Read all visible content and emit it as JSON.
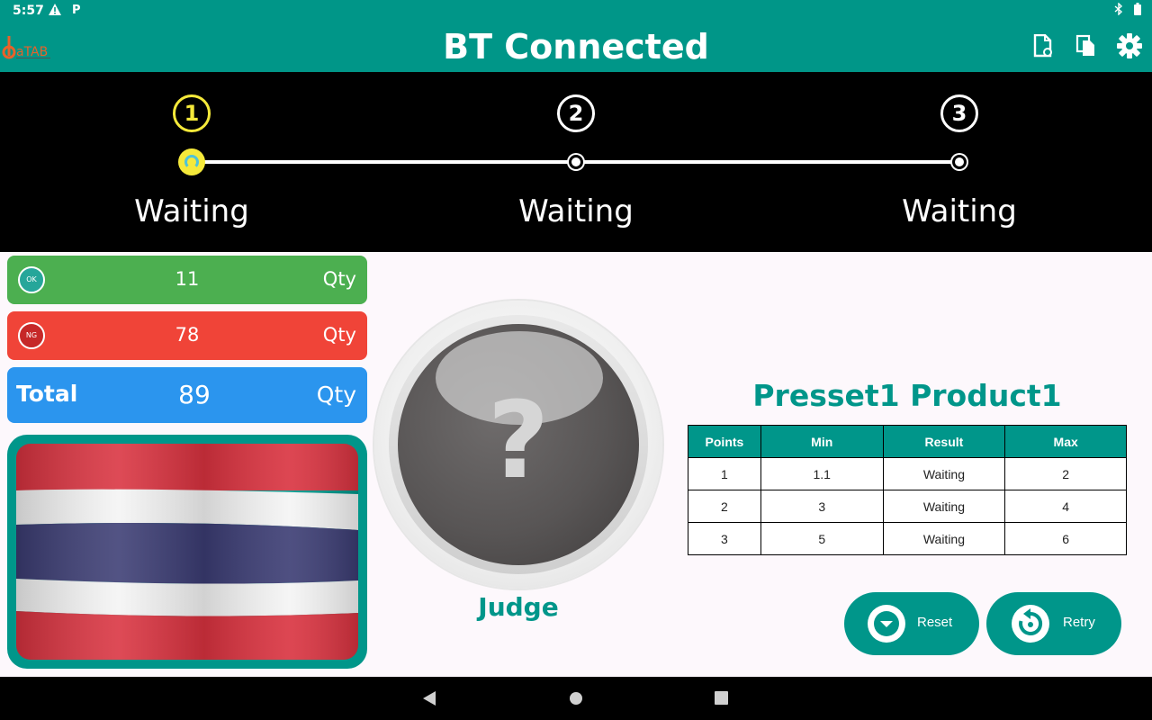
{
  "status_bar": {
    "time": "5:57",
    "icons": [
      "warning-icon",
      "p-icon",
      "bluetooth-icon",
      "battery-icon"
    ]
  },
  "app_bar": {
    "logo_text": "aTAB",
    "title": "BT Connected",
    "actions": [
      "file-settings-icon",
      "copy-icon",
      "settings-gear-icon"
    ]
  },
  "stepper": {
    "steps": [
      {
        "number": "1",
        "status": "Waiting"
      },
      {
        "number": "2",
        "status": "Waiting"
      },
      {
        "number": "3",
        "status": "Waiting"
      }
    ],
    "active_step": 1,
    "active_color": "#f5e93a"
  },
  "stats": {
    "ok": {
      "badge": "OK",
      "value": "11",
      "unit": "Qty"
    },
    "ng": {
      "badge": "NG",
      "value": "78",
      "unit": "Qty"
    },
    "total": {
      "label": "Total",
      "value": "89",
      "unit": "Qty"
    }
  },
  "flag": {
    "name": "thailand-flag"
  },
  "judge": {
    "symbol": "?",
    "label": "Judge"
  },
  "preset": {
    "title": "Presset1 Product1",
    "columns": [
      "Points",
      "Min",
      "Result",
      "Max"
    ],
    "rows": [
      [
        "1",
        "1.1",
        "Waiting",
        "2"
      ],
      [
        "2",
        "3",
        "Waiting",
        "4"
      ],
      [
        "3",
        "5",
        "Waiting",
        "6"
      ]
    ]
  },
  "buttons": {
    "reset": "Reset",
    "retry": "Retry"
  },
  "colors": {
    "primary": "#009688",
    "ok": "#4caf50",
    "ng": "#f04438",
    "total": "#2b95ee"
  }
}
